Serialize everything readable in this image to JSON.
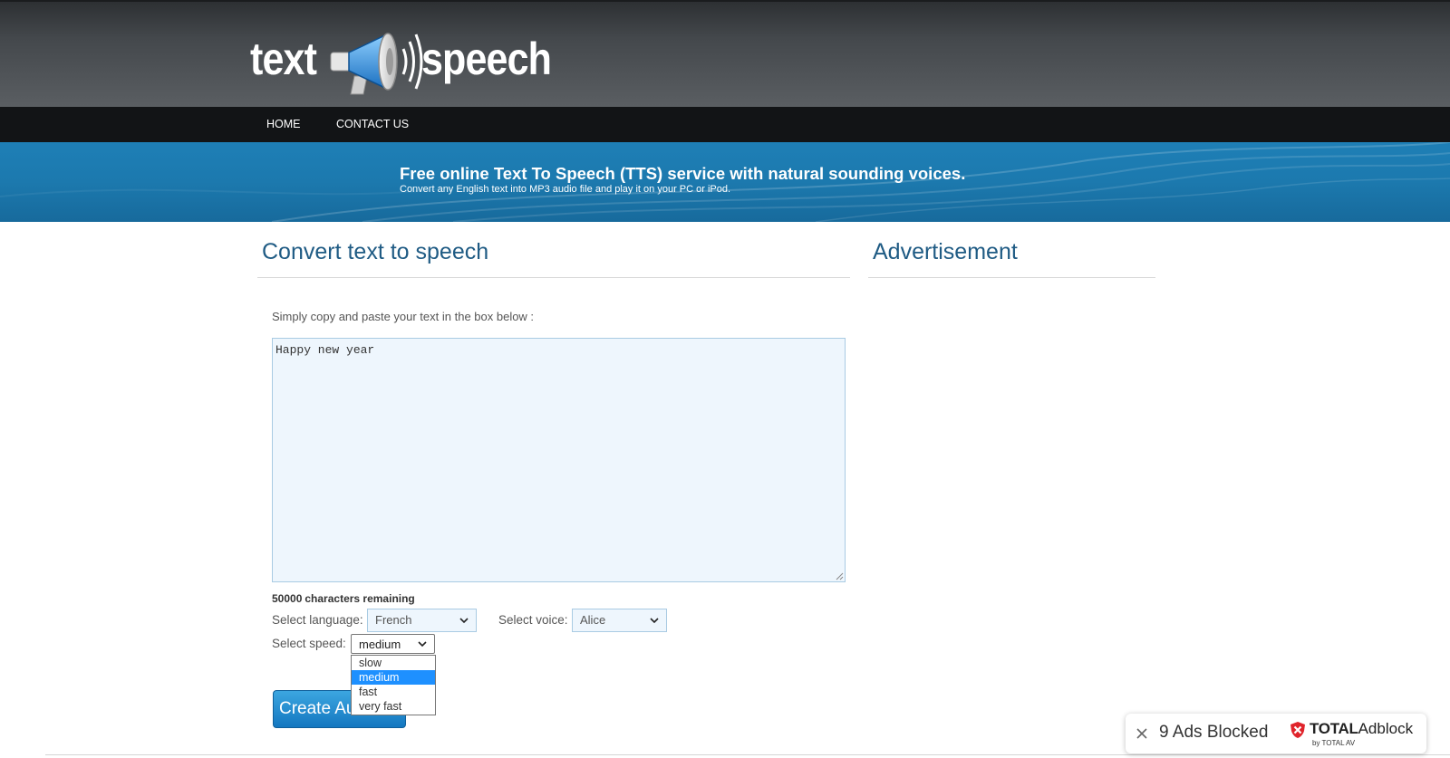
{
  "logo": {
    "word_left": "text",
    "word_right": "speech"
  },
  "nav": {
    "items": [
      {
        "label": "HOME"
      },
      {
        "label": "CONTACT US"
      }
    ]
  },
  "banner": {
    "title": "Free online Text To Speech (TTS) service with natural sounding voices.",
    "subtitle": "Convert any English text into MP3 audio file and play it on your PC or iPod."
  },
  "main": {
    "title": "Convert text to speech",
    "instruction": "Simply copy and paste your text in the box below :",
    "text_value": "Happy new year",
    "remaining_count": "50000",
    "remaining_label": "characters remaining",
    "language_label": "Select language:",
    "language_value": "French",
    "voice_label": "Select voice:",
    "voice_value": "Alice",
    "speed_label": "Select speed:",
    "speed_value": "medium",
    "speed_options": [
      {
        "label": "slow"
      },
      {
        "label": "medium",
        "selected": true
      },
      {
        "label": "fast"
      },
      {
        "label": "very fast"
      }
    ],
    "create_button": "Create Audio"
  },
  "sidebar": {
    "title": "Advertisement"
  },
  "adblock": {
    "count_text": "9 Ads Blocked",
    "brand_bold": "TOTAL",
    "brand_rest": "Adblock",
    "brand_sub": "by TOTAL AV"
  },
  "colors": {
    "accent_blue": "#1f5b84",
    "banner_blue": "#1c79ae",
    "selection_blue": "#1e90ff",
    "brand_red": "#e0242b"
  }
}
